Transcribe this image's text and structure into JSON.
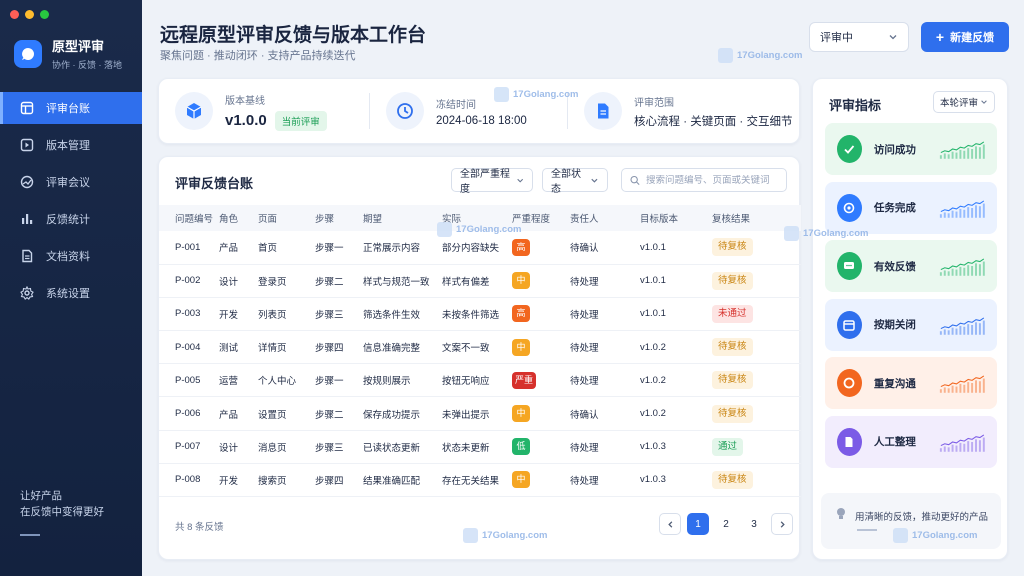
{
  "sidebar": {
    "brand_title": "原型评审",
    "brand_subtitle": "协作 · 反馈 · 落地",
    "items": [
      {
        "label": "评审台账",
        "icon": "table-icon",
        "active": true
      },
      {
        "label": "版本管理",
        "icon": "version-icon",
        "active": false
      },
      {
        "label": "评审会议",
        "icon": "meeting-icon",
        "active": false
      },
      {
        "label": "反馈统计",
        "icon": "bar-chart-icon",
        "active": false
      },
      {
        "label": "文档资料",
        "icon": "document-icon",
        "active": false
      },
      {
        "label": "系统设置",
        "icon": "gear-icon",
        "active": false
      }
    ],
    "footer_line1": "让好产品",
    "footer_line2": "在反馈中变得更好"
  },
  "header": {
    "title": "远程原型评审反馈与版本工作台",
    "subtitle": "聚焦问题 · 推动闭环 · 支持产品持续迭代",
    "status_select": "评审中",
    "new_button": "新建反馈"
  },
  "info": {
    "baseline_label": "版本基线",
    "baseline_value": "v1.0.0",
    "baseline_badge": "当前评审",
    "freeze_label": "冻结时间",
    "freeze_value": "2024-06-18 18:00",
    "scope_label": "评审范围",
    "scope_value": "核心流程 · 关键页面 · 交互细节"
  },
  "table": {
    "title": "评审反馈台账",
    "filter_severity": "全部严重程度",
    "filter_status": "全部状态",
    "search_placeholder": "搜索问题编号、页面或关键词",
    "columns": [
      "问题编号",
      "角色",
      "页面",
      "步骤",
      "期望",
      "实际",
      "严重程度",
      "责任人",
      "目标版本",
      "复核结果"
    ],
    "rows": [
      [
        "P-001",
        "产品",
        "首页",
        "步骤一",
        "正常展示内容",
        "部分内容缺失",
        "高",
        "待确认",
        "v1.0.1",
        "待复核"
      ],
      [
        "P-002",
        "设计",
        "登录页",
        "步骤二",
        "样式与规范一致",
        "样式有偏差",
        "中",
        "待处理",
        "v1.0.1",
        "待复核"
      ],
      [
        "P-003",
        "开发",
        "列表页",
        "步骤三",
        "筛选条件生效",
        "未按条件筛选",
        "高",
        "待处理",
        "v1.0.1",
        "未通过"
      ],
      [
        "P-004",
        "测试",
        "详情页",
        "步骤四",
        "信息准确完整",
        "文案不一致",
        "中",
        "待处理",
        "v1.0.2",
        "待复核"
      ],
      [
        "P-005",
        "运营",
        "个人中心",
        "步骤一",
        "按规则展示",
        "按钮无响应",
        "严重",
        "待处理",
        "v1.0.2",
        "待复核"
      ],
      [
        "P-006",
        "产品",
        "设置页",
        "步骤二",
        "保存成功提示",
        "未弹出提示",
        "中",
        "待确认",
        "v1.0.2",
        "待复核"
      ],
      [
        "P-007",
        "设计",
        "消息页",
        "步骤三",
        "已读状态更新",
        "状态未更新",
        "低",
        "待处理",
        "v1.0.3",
        "通过"
      ],
      [
        "P-008",
        "开发",
        "搜索页",
        "步骤四",
        "结果准确匹配",
        "存在无关结果",
        "中",
        "待处理",
        "v1.0.3",
        "待复核"
      ]
    ],
    "footer_count": "共 8 条反馈",
    "pages": [
      "1",
      "2",
      "3"
    ],
    "current_page": "1"
  },
  "metrics": {
    "title": "评审指标",
    "select": "本轮评审",
    "items": [
      {
        "label": "访问成功",
        "icon": "check-icon",
        "color": "#22b46a",
        "bg": "#eaf8ef"
      },
      {
        "label": "任务完成",
        "icon": "target-icon",
        "color": "#2f7bff",
        "bg": "#ebf2ff"
      },
      {
        "label": "有效反馈",
        "icon": "chat-icon",
        "color": "#22b46a",
        "bg": "#eaf8ef"
      },
      {
        "label": "按期关闭",
        "icon": "calendar-icon",
        "color": "#2f6fed",
        "bg": "#ebf2ff"
      },
      {
        "label": "重复沟通",
        "icon": "cycle-icon",
        "color": "#f2661f",
        "bg": "#fff0e8"
      },
      {
        "label": "人工整理",
        "icon": "document-icon",
        "color": "#7b5be6",
        "bg": "#f2edfd"
      }
    ],
    "footer": "用清晰的反馈，推动更好的产品"
  },
  "watermark": "17Golang.com",
  "colors": {
    "accent": "#2f6fed",
    "sev_high": "#f2661f",
    "sev_mid": "#f5a623",
    "sev_critical": "#d6312c",
    "sev_low": "#22b46a"
  }
}
